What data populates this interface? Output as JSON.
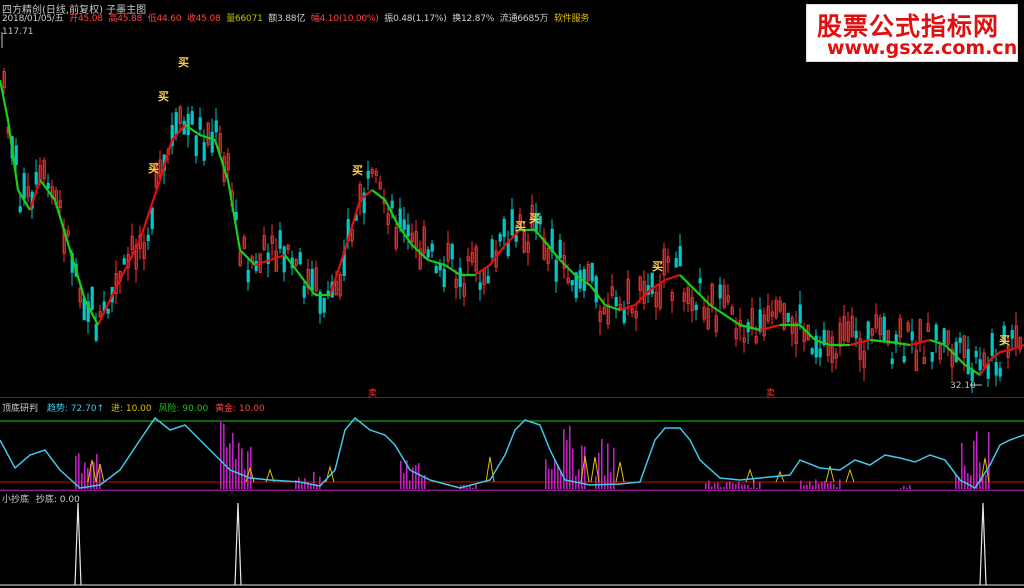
{
  "header": {
    "title": "四方精创(日线,前复权) 子墨主图",
    "date": "2018/01/05/五",
    "open": "开45.08",
    "high": "高45.88",
    "low": "低44.60",
    "close": "收45.08",
    "volume": "量66071",
    "amount": "额3.88亿",
    "change": "幅4.10(10.00%)",
    "amplitude": "振0.48(1.17%)",
    "turnover": "换12.87%",
    "float": "流通6685万",
    "service": "软件服务"
  },
  "price_labels": {
    "max": "117.71",
    "min": "32.10"
  },
  "indicator1": {
    "name": "顶底研判",
    "trend": "趋势: 72.70↑",
    "enter": "进: 10.00",
    "risk": "风险: 90.00",
    "gold": "黄金: 10.00"
  },
  "indicator2": {
    "name": "小抄底",
    "value": "抄底: 0.00"
  },
  "watermark": {
    "line1": "股票公式指标网",
    "line2": "www.gsxz.com.cn"
  },
  "signal_char": "买",
  "sell_char": "卖",
  "colors": {
    "up": "#ff3030",
    "down": "#00c8c8",
    "ma_up": "#e01010",
    "ma_down": "#18d018",
    "trend": "#40c8e8",
    "bars": "#c020c0"
  }
}
